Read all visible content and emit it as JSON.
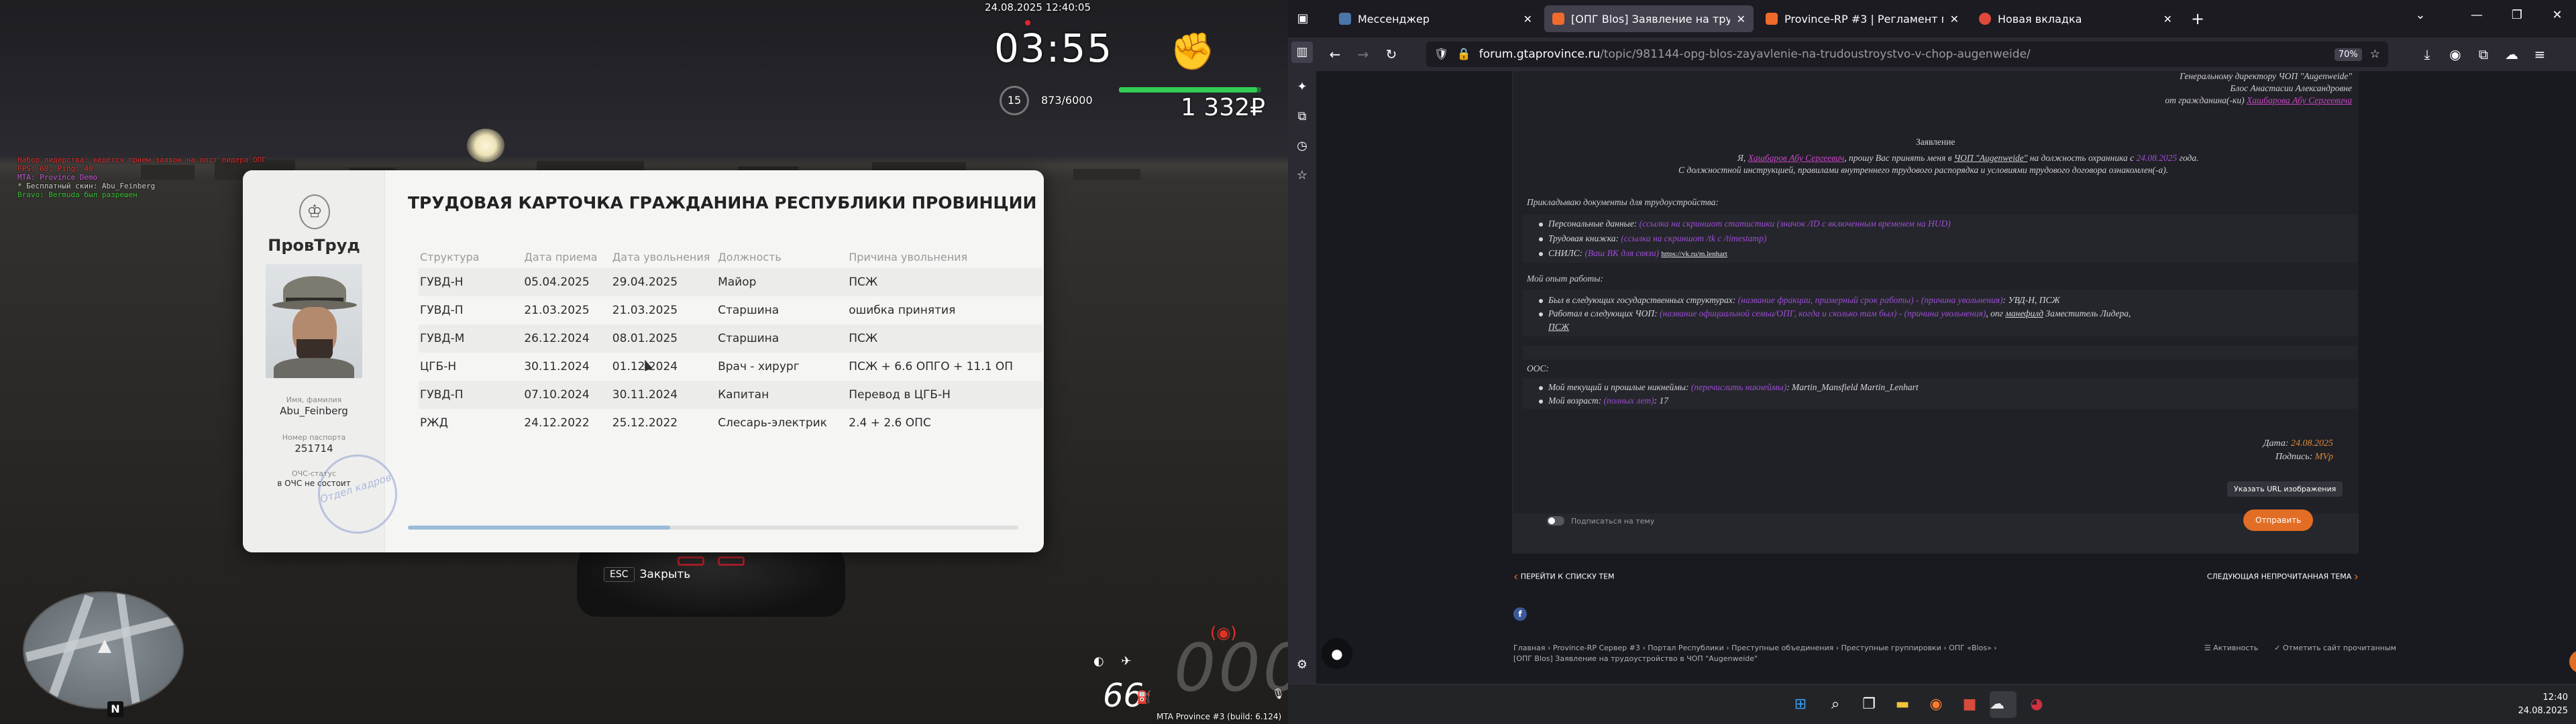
{
  "game": {
    "chat": [
      {
        "text": "Набор лидерства: ведётся прием заявок на пост лидера ОПГ",
        "color": "#e03030"
      },
      {
        "text": "FPS: 60. Ping: 40",
        "color": "#e03030"
      },
      {
        "text": "MTA: Province Demo",
        "color": "#c858d8"
      },
      {
        "text": "* Бесплатный скин: Abu_Feinberg",
        "color": "#cfcfcf"
      },
      {
        "text": "Bravo: Bermuda был разрешен",
        "color": "#3ec03e"
      }
    ],
    "hud": {
      "date": "24.08.2025 12:40:05",
      "time": "03:55",
      "level": "15",
      "xp": "873/6000",
      "money": "1 332₽",
      "health_fraction": 0.97
    },
    "card": {
      "title": "ТРУДОВАЯ КАРТОЧКА ГРАЖДАНИНА РЕСПУБЛИКИ ПРОВИНЦИИ",
      "dept": "ПровТруд",
      "name_label": "Имя, фамилия",
      "name": "Abu_Feinberg",
      "passport_label": "Номер паспорта",
      "passport": "251714",
      "ochs_label": "ОЧС-статус",
      "ochs": "в ОЧС не состоит",
      "stamp": "Отдел кадров",
      "headers": [
        "Структура",
        "Дата приема",
        "Дата увольнения",
        "Должность",
        "Причина увольнения"
      ],
      "rows": [
        [
          "ГУВД-Н",
          "05.04.2025",
          "29.04.2025",
          "Майор",
          "ПСЖ"
        ],
        [
          "ГУВД-П",
          "21.03.2025",
          "21.03.2025",
          "Старшина",
          "ошибка принятия"
        ],
        [
          "ГУВД-М",
          "26.12.2024",
          "08.01.2025",
          "Старшина",
          "ПСЖ"
        ],
        [
          "ЦГБ-Н",
          "30.11.2024",
          "01.12.2024",
          "Врач - хирург",
          "ПСЖ + 6.6 ОПГО + 11.1 ОП"
        ],
        [
          "ГУВД-П",
          "07.10.2024",
          "30.11.2024",
          "Капитан",
          "Перевод в ЦГБ-Н"
        ],
        [
          "РЖД",
          "24.12.2022",
          "25.12.2022",
          "Слесарь-электрик",
          "2.4 + 2.6 ОПС"
        ]
      ],
      "scroll_fraction": 0.43
    },
    "esc_key": "ESC",
    "esc_label": "Закрыть",
    "speed": "66",
    "compass": "N",
    "build": "MTA Province #3 (build: 6.124)"
  },
  "browser": {
    "tabs": [
      {
        "title": "Мессенджер",
        "color": "#4a76a8",
        "active": false
      },
      {
        "title": "[ОПГ Blos] Заявление на трудоустройство",
        "color": "#ef6a2b",
        "active": true
      },
      {
        "title": "Province-RP #3 | Регламент проведения",
        "color": "#ef6a2b",
        "active": false
      },
      {
        "title": "Новая вкладка",
        "color": "#e0493a",
        "active": false
      }
    ],
    "new_tab": "+",
    "url_host": "forum.gtaprovince.ru",
    "url_path": "/topic/981144-opg-blos-zayavlenie-na-trudoustroystvo-v-chop-augenweide/",
    "zoom": "70%",
    "letter": {
      "h1": "Генеральному директору ЧОП \"Augenweide\"",
      "h2": "Блос Анастасии Александровне",
      "h3a": "от гражданина(-ки) ",
      "h3b": "Хашбарова Абу Сергеевича",
      "title": "Заявление",
      "l1a": "Я, ",
      "l1b": "Хашбаров Абу Сергеевич",
      "l1c": ", прошу Вас принять меня в ",
      "l1d": "ЧОП \"Augenweide\"",
      "l1e": " на должность охранника с ",
      "l1f": "24.08.2025",
      "l1g": " года.",
      "l2": "С должностной инструкцией, правилами внутреннего трудового распорядка и условиями трудового договора ознакомлен(-а).",
      "docs_head": "Прикладываю документы для трудоустройства:",
      "d1a": "Персональные данные: ",
      "d1b": "(ссылка на скриншот статистики (значок /ID с включенным временем на HUD)",
      "d2a": "Трудовая книжка: ",
      "d2b": "(ссылка на скриншот /tk с /timestamp)",
      "d3a": "СНИЛС: ",
      "d3b": "(Ваш ВК для связи)",
      "d3c": "https://vk.ru/m.lenhart",
      "exp_head": "Мой опыт работы:",
      "e1a": "Был в следующих государственных структурах: ",
      "e1b": "(название фракции, примерный срок работы) - (причина увольнения)",
      "e1c": ": УВД-Н, ПСЖ",
      "e2a": "Работал в следующих ЧОП: ",
      "e2b": "(название официальной семьи/ОПГ, когда и сколько там был) - (причина увольнения)",
      "e2c": ", опг ",
      "e2d": "манефилд",
      "e2e": " Заместитель Лидера,",
      "e2f": "ПСЖ",
      "oos": "OOC:",
      "o1a": "Мой текущий и прошлые никнеймы: ",
      "o1b": "(перечислить никнеймы)",
      "o1c": ": Martin_Mansfield Martin_Lenhart",
      "o2a": "Мой возраст: ",
      "o2b": "(полных лет)",
      "o2c": ": 17",
      "date_l": "Дата: ",
      "date_v": "24.08.2025",
      "sign_l": "Подпись: ",
      "sign_v": "MVp"
    },
    "insert_url_btn": "Указать URL изображения",
    "subscribe": "Подписаться на тему",
    "send_btn": "Отправить",
    "prev_link": "ПЕРЕЙТИ К СПИСКУ ТЕМ",
    "next_link": "СЛЕДУЮЩАЯ НЕПРОЧИТАННАЯ ТЕМА",
    "breadcrumb": "Главная  ›  Province-RP Сервер #3  ›  Портал Республики  ›  Преступные объединения  ›  Преступные группировки  ›  ОПГ «Blos»  ›",
    "breadcrumb2": "[ОПГ Blos] Заявление на трудоустройство в ЧОП \"Augenweide\"",
    "activity": "Активность",
    "mark_read": "Отметить сайт прочитанным"
  },
  "taskbar": {
    "time": "12:40",
    "date": "24.08.2025"
  }
}
